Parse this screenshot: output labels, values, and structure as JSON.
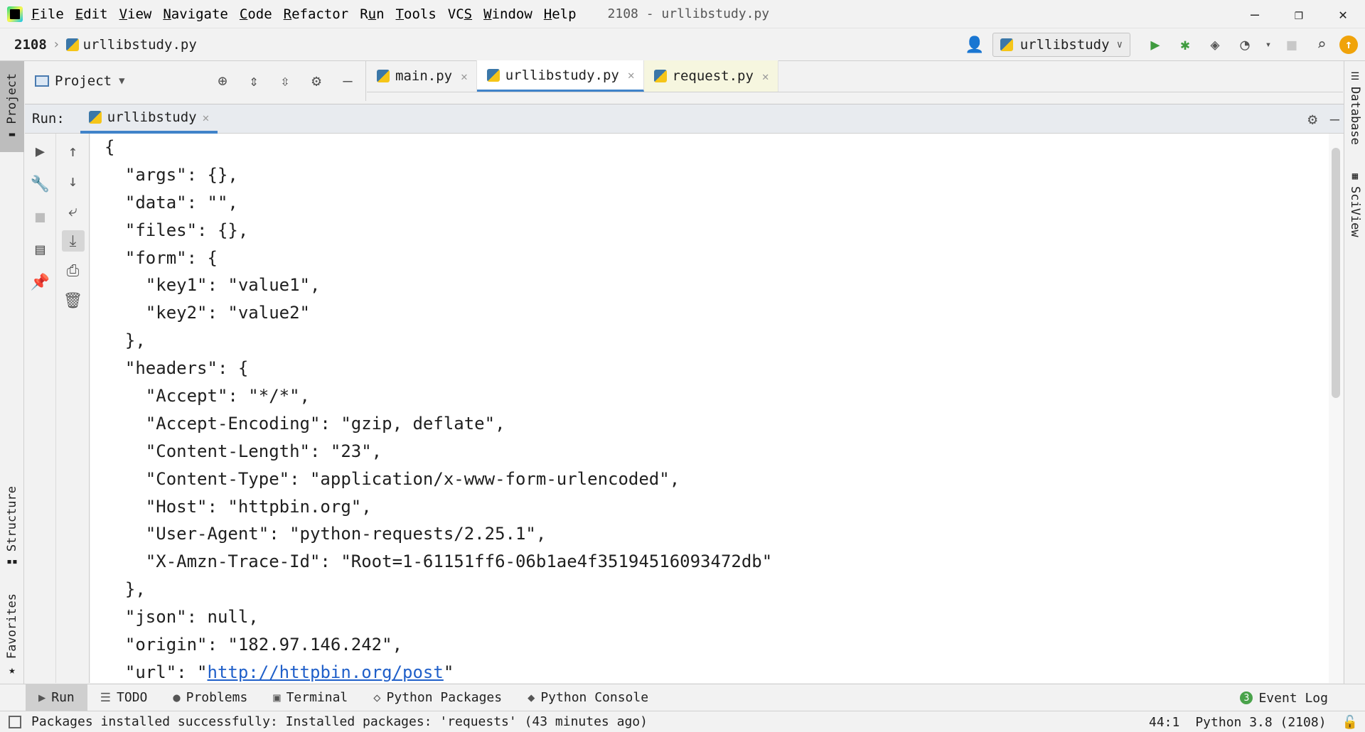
{
  "menubar": {
    "items": [
      {
        "label": "File",
        "mnemonic": "F",
        "rest": "ile"
      },
      {
        "label": "Edit",
        "mnemonic": "E",
        "rest": "dit"
      },
      {
        "label": "View",
        "mnemonic": "V",
        "rest": "iew"
      },
      {
        "label": "Navigate",
        "mnemonic": "N",
        "rest": "avigate"
      },
      {
        "label": "Code",
        "mnemonic": "C",
        "rest": "ode"
      },
      {
        "label": "Refactor",
        "mnemonic": "R",
        "rest": "efactor"
      },
      {
        "label": "Run",
        "mnemonic": "u",
        "pre": "R",
        "rest": "n"
      },
      {
        "label": "Tools",
        "mnemonic": "T",
        "rest": "ools"
      },
      {
        "label": "VCS",
        "mnemonic": "S",
        "pre": "VC",
        "rest": ""
      },
      {
        "label": "Window",
        "mnemonic": "W",
        "rest": "indow"
      },
      {
        "label": "Help",
        "mnemonic": "H",
        "rest": "elp"
      }
    ],
    "window_title": "2108 - urllibstudy.py"
  },
  "navbar": {
    "project": "2108",
    "file": "urllibstudy.py",
    "run_config": "urllibstudy"
  },
  "left_strip": {
    "project": "Project",
    "structure": "Structure",
    "favorites": "Favorites"
  },
  "right_strip": {
    "database": "Database",
    "sciview": "SciView"
  },
  "project_panel": {
    "title": "Project"
  },
  "editor_tabs": [
    {
      "label": "main.py"
    },
    {
      "label": "urllibstudy.py"
    },
    {
      "label": "request.py"
    }
  ],
  "run_panel": {
    "label": "Run:",
    "tab": "urllibstudy"
  },
  "console": {
    "lines": [
      "{",
      "  \"args\": {},",
      "  \"data\": \"\",",
      "  \"files\": {},",
      "  \"form\": {",
      "    \"key1\": \"value1\",",
      "    \"key2\": \"value2\"",
      "  },",
      "  \"headers\": {",
      "    \"Accept\": \"*/*\",",
      "    \"Accept-Encoding\": \"gzip, deflate\",",
      "    \"Content-Length\": \"23\",",
      "    \"Content-Type\": \"application/x-www-form-urlencoded\",",
      "    \"Host\": \"httpbin.org\",",
      "    \"User-Agent\": \"python-requests/2.25.1\",",
      "    \"X-Amzn-Trace-Id\": \"Root=1-61151ff6-06b1ae4f35194516093472db\"",
      "  },",
      "  \"json\": null,",
      "  \"origin\": \"182.97.146.242\","
    ],
    "url_prefix": "  \"url\": \"",
    "url_link": "http://httpbin.org/post",
    "url_suffix": "\""
  },
  "bottom_bar": {
    "run": "Run",
    "todo": "TODO",
    "problems": "Problems",
    "terminal": "Terminal",
    "python_packages": "Python Packages",
    "python_console": "Python Console",
    "event_log": "Event Log",
    "event_count": "3"
  },
  "statusbar": {
    "message": "Packages installed successfully: Installed packages: 'requests' (43 minutes ago)",
    "position": "44:1",
    "interpreter": "Python 3.8 (2108)"
  },
  "colors": {
    "accent": "#4083c9",
    "run_green": "#3e9b3e",
    "link": "#1f5fc9"
  }
}
